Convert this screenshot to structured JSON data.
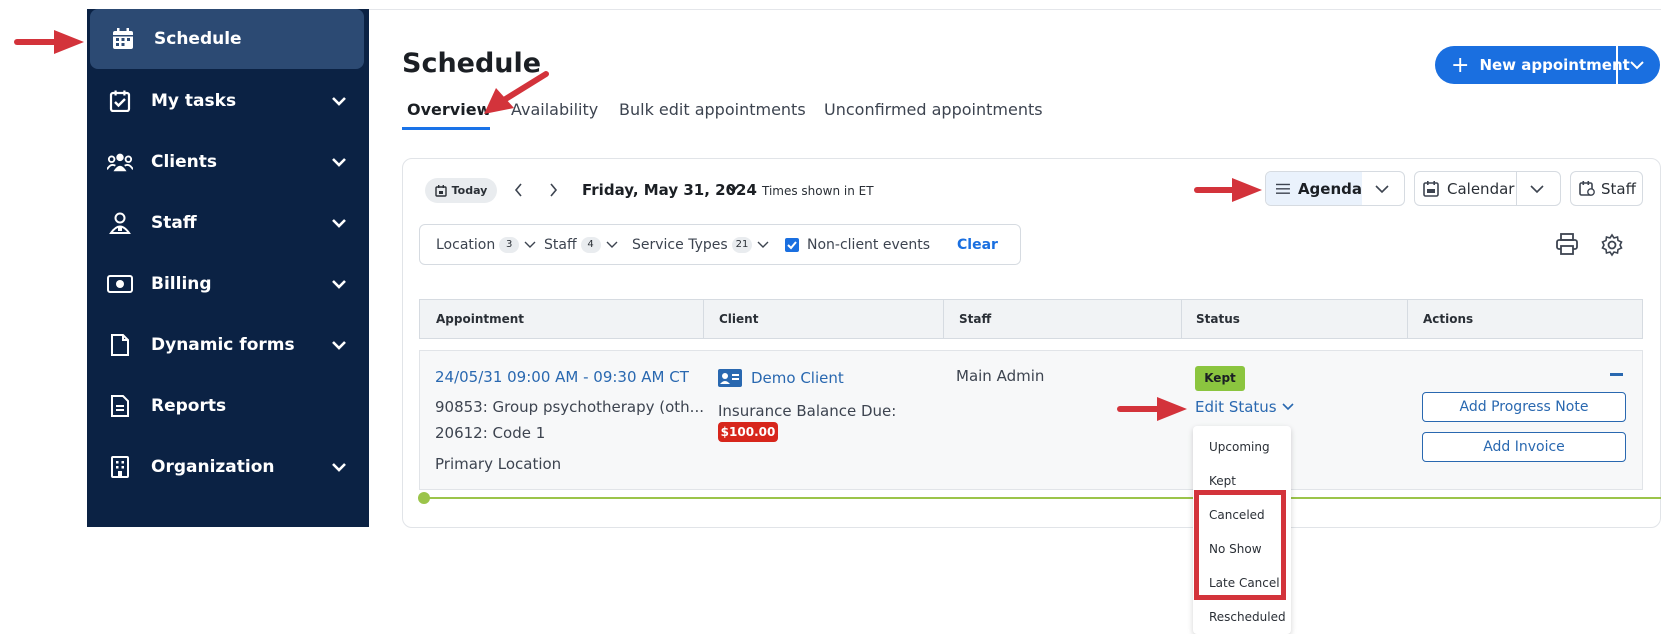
{
  "sidebar": {
    "items": [
      {
        "label": "Schedule",
        "icon": "calendar-icon",
        "active": true
      },
      {
        "label": "My tasks",
        "icon": "task-check-icon"
      },
      {
        "label": "Clients",
        "icon": "clients-group-icon"
      },
      {
        "label": "Staff",
        "icon": "staff-person-icon"
      },
      {
        "label": "Billing",
        "icon": "billing-money-icon"
      },
      {
        "label": "Dynamic forms",
        "icon": "document-icon"
      },
      {
        "label": "Reports",
        "icon": "report-icon"
      },
      {
        "label": "Organization",
        "icon": "building-icon"
      }
    ]
  },
  "header": {
    "title": "Schedule",
    "new_appointment_label": "New appointment",
    "tabs": [
      "Overview",
      "Availability",
      "Bulk edit appointments",
      "Unconfirmed appointments"
    ]
  },
  "toolbar": {
    "today_label": "Today",
    "date": "Friday, May 31, 2024",
    "timezone_note": "Times shown in ET",
    "agenda_label": "Agenda",
    "calendar_label": "Calendar",
    "staff_label": "Staff"
  },
  "filters": {
    "location_label": "Location",
    "location_count": "3",
    "staff_label": "Staff",
    "staff_count": "4",
    "service_types_label": "Service Types",
    "service_types_count": "21",
    "non_client_label": "Non-client events",
    "clear_label": "Clear"
  },
  "table": {
    "columns": [
      "Appointment",
      "Client",
      "Staff",
      "Status",
      "Actions"
    ],
    "row": {
      "time": "24/05/31 09:00 AM - 09:30 AM CT",
      "service_1": "90853: Group psychotherapy (oth...",
      "service_2": "20612: Code 1",
      "location": "Primary Location",
      "client_name": "Demo Client",
      "insurance_label": "Insurance Balance Due:",
      "balance": "$100.00",
      "staff": "Main Admin",
      "status": "Kept",
      "edit_status_label": "Edit Status",
      "add_progress_note": "Add Progress Note",
      "add_invoice": "Add Invoice"
    }
  },
  "status_dropdown": {
    "options": [
      "Upcoming",
      "Kept",
      "Canceled",
      "No Show",
      "Late Cancel",
      "Rescheduled"
    ],
    "highlighted": [
      "Canceled",
      "No Show",
      "Late Cancel"
    ]
  },
  "colors": {
    "sidebar_bg": "#0b2244",
    "primary": "#1a6fe0",
    "link": "#2968b0",
    "kept_badge": "#8bc53f",
    "balance_badge": "#d7261c",
    "annotation_red": "#d3333b"
  }
}
